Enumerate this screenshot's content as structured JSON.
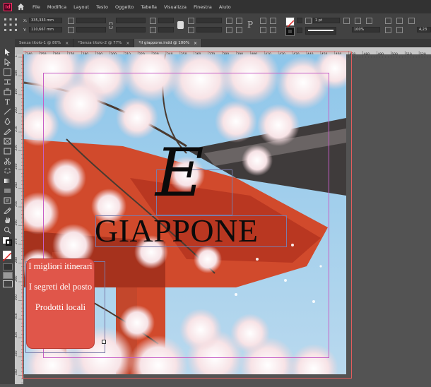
{
  "app": {
    "logo": "Id"
  },
  "menu": [
    "File",
    "Modifica",
    "Layout",
    "Testo",
    "Oggetto",
    "Tabella",
    "Visualizza",
    "Finestra",
    "Aiuto"
  ],
  "control": {
    "x_label": "X:",
    "x_value": "335,333 mm",
    "y_label": "Y:",
    "y_value": "110,667 mm",
    "stroke_weight": "1 pt",
    "zoom": "100%",
    "value": "4,23"
  },
  "tabs": [
    {
      "label": "Senza titolo-1 @ 80%",
      "active": false
    },
    {
      "label": "*Senza titolo-2 @ 77%",
      "active": false
    },
    {
      "label": "*il giappone.indd @ 100%",
      "active": true
    }
  ],
  "ruler_top": [
    "240",
    "250",
    "260",
    "270",
    "280",
    "290",
    "300",
    "310",
    "320",
    "330",
    "340",
    "350",
    "360",
    "370",
    "380",
    "390",
    "400",
    "410",
    "420",
    "430",
    "440",
    "450",
    "460",
    "470",
    "480",
    "490",
    "500",
    "510",
    "520"
  ],
  "ruler_left": [
    "170",
    "180",
    "190",
    "200",
    "210",
    "220",
    "230",
    "240",
    "250",
    "260",
    "270",
    "280",
    "290",
    "300",
    "310",
    "320",
    "330",
    "340"
  ],
  "document": {
    "ornament": "E",
    "title": "GIAPPONE",
    "box_items": [
      "I migliori itinerari",
      "I segreti del posto",
      "Prodotti locali"
    ]
  }
}
